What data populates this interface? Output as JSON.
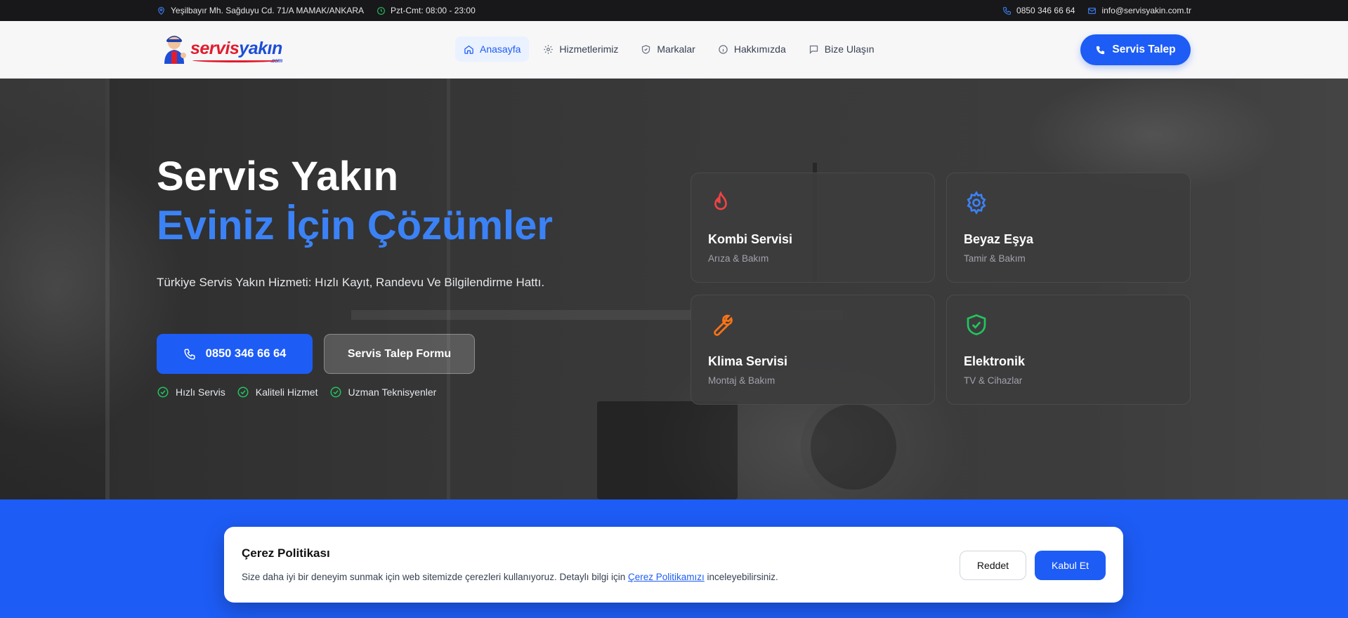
{
  "topbar": {
    "address": "Yeşilbayır Mh. Sağduyu Cd. 71/A MAMAK/ANKARA",
    "hours": "Pzt-Cmt: 08:00 - 23:00",
    "phone": "0850 346 66 64",
    "email": "info@servisyakin.com.tr"
  },
  "logo": {
    "part1": "servis",
    "part2": "yakın",
    "suffix": ".com"
  },
  "nav": {
    "items": [
      {
        "label": "Anasayfa",
        "icon": "home-icon"
      },
      {
        "label": "Hizmetlerimiz",
        "icon": "gear-icon"
      },
      {
        "label": "Markalar",
        "icon": "shield-icon"
      },
      {
        "label": "Hakkımızda",
        "icon": "info-icon"
      },
      {
        "label": "Bize Ulaşın",
        "icon": "chat-icon"
      }
    ],
    "cta": "Servis Talep"
  },
  "hero": {
    "title_line1": "Servis Yakın",
    "title_line2": "Eviniz İçin Çözümler",
    "subtitle": "Türkiye Servis Yakın Hizmeti: Hızlı Kayıt, Randevu Ve Bilgilendirme Hattı.",
    "phone_button": "0850 346 66 64",
    "form_button": "Servis Talep Formu",
    "checks": [
      "Hızlı Servis",
      "Kaliteli Hizmet",
      "Uzman Teknisyenler"
    ]
  },
  "cards": [
    {
      "title": "Kombi Servisi",
      "subtitle": "Arıza & Bakım",
      "icon": "flame-icon",
      "color": "#ef4444"
    },
    {
      "title": "Beyaz Eşya",
      "subtitle": "Tamir & Bakım",
      "icon": "gear-icon",
      "color": "#3b82f6"
    },
    {
      "title": "Klima Servisi",
      "subtitle": "Montaj & Bakım",
      "icon": "wrench-icon",
      "color": "#f97316"
    },
    {
      "title": "Elektronik",
      "subtitle": "TV & Cihazlar",
      "icon": "shield-check-icon",
      "color": "#22c55e"
    }
  ],
  "cookie": {
    "title": "Çerez Politikası",
    "text_before": "Size daha iyi bir deneyim sunmak için web sitemizde çerezleri kullanıyoruz. Detaylı bilgi için ",
    "link": "Çerez Politikamızı",
    "text_after": " inceleyebilirsiniz.",
    "reject": "Reddet",
    "accept": "Kabul Et"
  },
  "colors": {
    "primary": "#1d5cf5",
    "accent_title": "#3b82f6",
    "topbar": "#18181b",
    "check": "#22c55e"
  }
}
